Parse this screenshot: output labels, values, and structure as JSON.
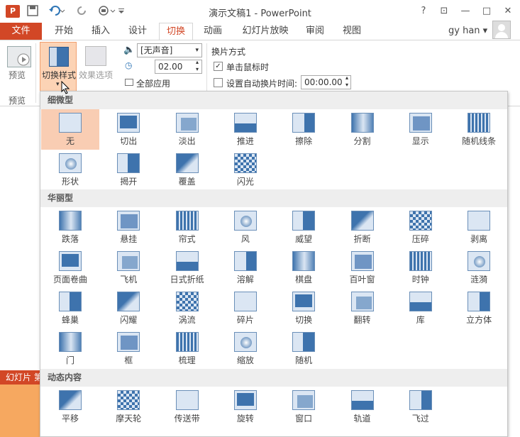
{
  "window": {
    "title": "演示文稿1 - PowerPoint",
    "app_icon": "P",
    "help": "?",
    "controls": [
      "⊡",
      "—",
      "□",
      "✕"
    ]
  },
  "qat": {
    "save_icon": "save-icon",
    "undo_icon": "undo-icon",
    "redo_icon": "redo-icon",
    "customize_icon": "customize-icon"
  },
  "tabs": {
    "file": "文件",
    "items": [
      "开始",
      "插入",
      "设计",
      "切换",
      "动画",
      "幻灯片放映",
      "审阅",
      "视图"
    ],
    "active": "切换",
    "user": "gy han ▾"
  },
  "ribbon": {
    "preview_label": "预览",
    "preview_group": "预览",
    "transition_style": "切换样式",
    "effect_options": "效果选项",
    "sound_value": "[无声音]",
    "duration_value": "02.00",
    "apply_all": "全部应用",
    "advance_title": "换片方式",
    "on_click": "单击鼠标时",
    "after_time": "设置自动换片时间:",
    "after_value": "00:00.00",
    "accent": "#d24726"
  },
  "slide_area": {
    "status_text": "幻灯片 第"
  },
  "gallery": {
    "sections": [
      {
        "title": "细微型",
        "items": [
          "无",
          "切出",
          "淡出",
          "推进",
          "擦除",
          "分割",
          "显示",
          "随机线条",
          "形状",
          "揭开",
          "覆盖",
          "闪光"
        ]
      },
      {
        "title": "华丽型",
        "items": [
          "跌落",
          "悬挂",
          "帘式",
          "风",
          "威望",
          "折断",
          "压碎",
          "剥离",
          "页面卷曲",
          "飞机",
          "日式折纸",
          "溶解",
          "棋盘",
          "百叶窗",
          "时钟",
          "涟漪",
          "蜂巢",
          "闪耀",
          "涡流",
          "碎片",
          "切换",
          "翻转",
          "库",
          "立方体",
          "门",
          "框",
          "梳理",
          "缩放",
          "随机"
        ]
      },
      {
        "title": "动态内容",
        "items": [
          "平移",
          "摩天轮",
          "传送带",
          "旋转",
          "窗口",
          "轨道",
          "飞过"
        ]
      }
    ],
    "selected": "无"
  }
}
